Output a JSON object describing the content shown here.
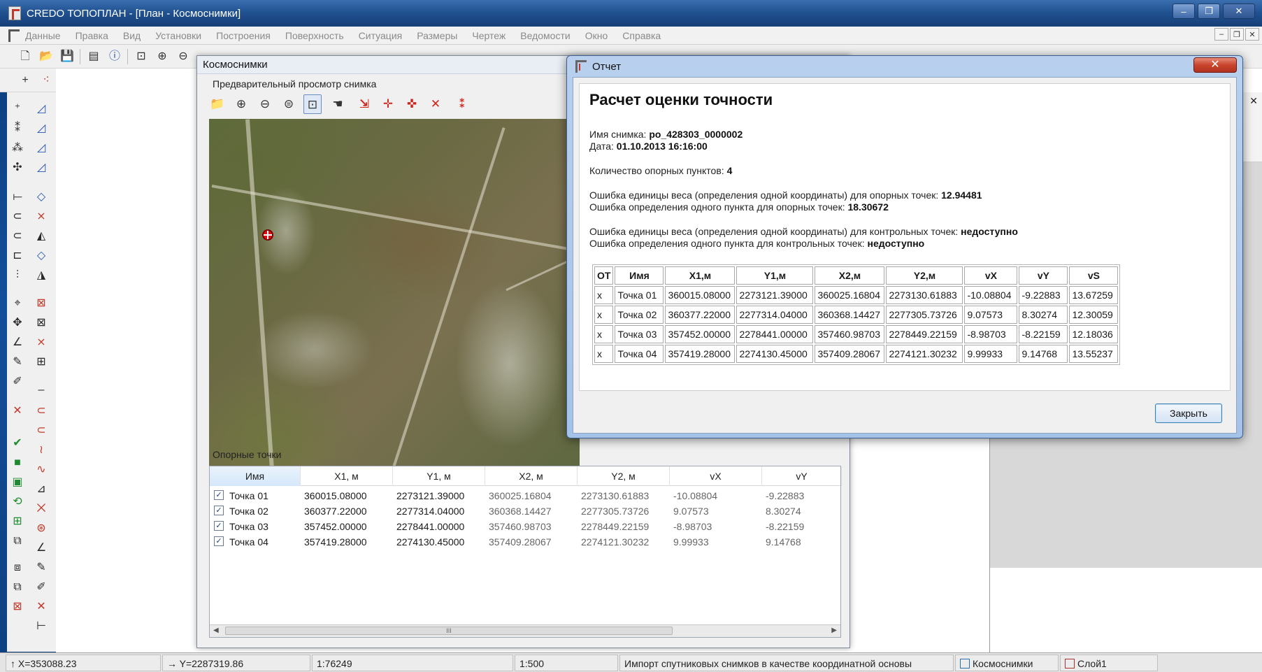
{
  "app": {
    "title": "CREDO ТОПОПЛАН - [План - Космоснимки]",
    "window_buttons": [
      "–",
      "❐",
      "✕"
    ]
  },
  "menu": {
    "items": [
      "Данные",
      "Правка",
      "Вид",
      "Установки",
      "Построения",
      "Поверхность",
      "Ситуация",
      "Размеры",
      "Чертеж",
      "Ведомости",
      "Окно",
      "Справка"
    ],
    "mdi_buttons": [
      "–",
      "❐",
      "✕"
    ]
  },
  "kosmo": {
    "title": "Космоснимки",
    "preview_label": "Предварительный просмотр снимка",
    "points_label": "Опорные точки",
    "grid": {
      "columns": [
        "Имя",
        "X1, м",
        "Y1, м",
        "X2, м",
        "Y2, м",
        "vX",
        "vY"
      ],
      "rows": [
        {
          "name": "Точка 01",
          "x1": "360015.08000",
          "y1": "2273121.39000",
          "x2": "360025.16804",
          "y2": "2273130.61883",
          "vx": "-10.08804",
          "vy": "-9.22883"
        },
        {
          "name": "Точка 02",
          "x1": "360377.22000",
          "y1": "2277314.04000",
          "x2": "360368.14427",
          "y2": "2277305.73726",
          "vx": "9.07573",
          "vy": "8.30274"
        },
        {
          "name": "Точка 03",
          "x1": "357452.00000",
          "y1": "2278441.00000",
          "x2": "357460.98703",
          "y2": "2278449.22159",
          "vx": "-8.98703",
          "vy": "-8.22159"
        },
        {
          "name": "Точка 04",
          "x1": "357419.28000",
          "y1": "2274130.45000",
          "x2": "357409.28067",
          "y2": "2274121.30232",
          "vx": "9.99933",
          "vy": "9.14768"
        }
      ]
    },
    "scroll_thumb": "III"
  },
  "report": {
    "title": "Отчет",
    "close_x": "✕",
    "heading": "Расчет оценки точности",
    "image_name_label": "Имя снимка:",
    "image_name": "po_428303_0000002",
    "date_label": "Дата:",
    "date": "01.10.2013 16:16:00",
    "count_label": "Количество опорных пунктов:",
    "count": "4",
    "err_weight_ref_label": "Ошибка единицы веса (определения одной координаты) для опорных точек:",
    "err_weight_ref": "12.94481",
    "err_point_ref_label": "Ошибка определения одного пункта для опорных точек:",
    "err_point_ref": "18.30672",
    "err_weight_ctrl_label": "Ошибка единицы веса (определения одной координаты) для контрольных точек:",
    "err_weight_ctrl": "недоступно",
    "err_point_ctrl_label": "Ошибка определения одного пункта для контрольных точек:",
    "err_point_ctrl": "недоступно",
    "table": {
      "columns": [
        "ОТ",
        "Имя",
        "X1,м",
        "Y1,м",
        "X2,м",
        "Y2,м",
        "vX",
        "vY",
        "vS"
      ],
      "rows": [
        [
          "x",
          "Точка 01",
          "360015.08000",
          "2273121.39000",
          "360025.16804",
          "2273130.61883",
          "-10.08804",
          "-9.22883",
          "13.67259"
        ],
        [
          "x",
          "Точка 02",
          "360377.22000",
          "2277314.04000",
          "360368.14427",
          "2277305.73726",
          "9.07573",
          "8.30274",
          "12.30059"
        ],
        [
          "x",
          "Точка 03",
          "357452.00000",
          "2278441.00000",
          "357460.98703",
          "2278449.22159",
          "-8.98703",
          "-8.22159",
          "12.18036"
        ],
        [
          "x",
          "Точка 04",
          "357419.28000",
          "2274130.45000",
          "357409.28067",
          "2274121.30232",
          "9.99933",
          "9.14768",
          "13.55237"
        ]
      ]
    },
    "close_button": "Закрыть"
  },
  "status": {
    "x": "↑ X=353088.23",
    "y": "→ Y=2287319.86",
    "scale1": "1:76249",
    "scale2": "1:500",
    "message": "Импорт спутниковых снимков в качестве координатной основы",
    "layer_tab": "Космоснимки",
    "layer": "Слой1"
  },
  "colors": {
    "background": "#134e9a",
    "report_frame": "#a5c2e8",
    "close_red": "#c9442c",
    "marker_red": "#e01010"
  }
}
